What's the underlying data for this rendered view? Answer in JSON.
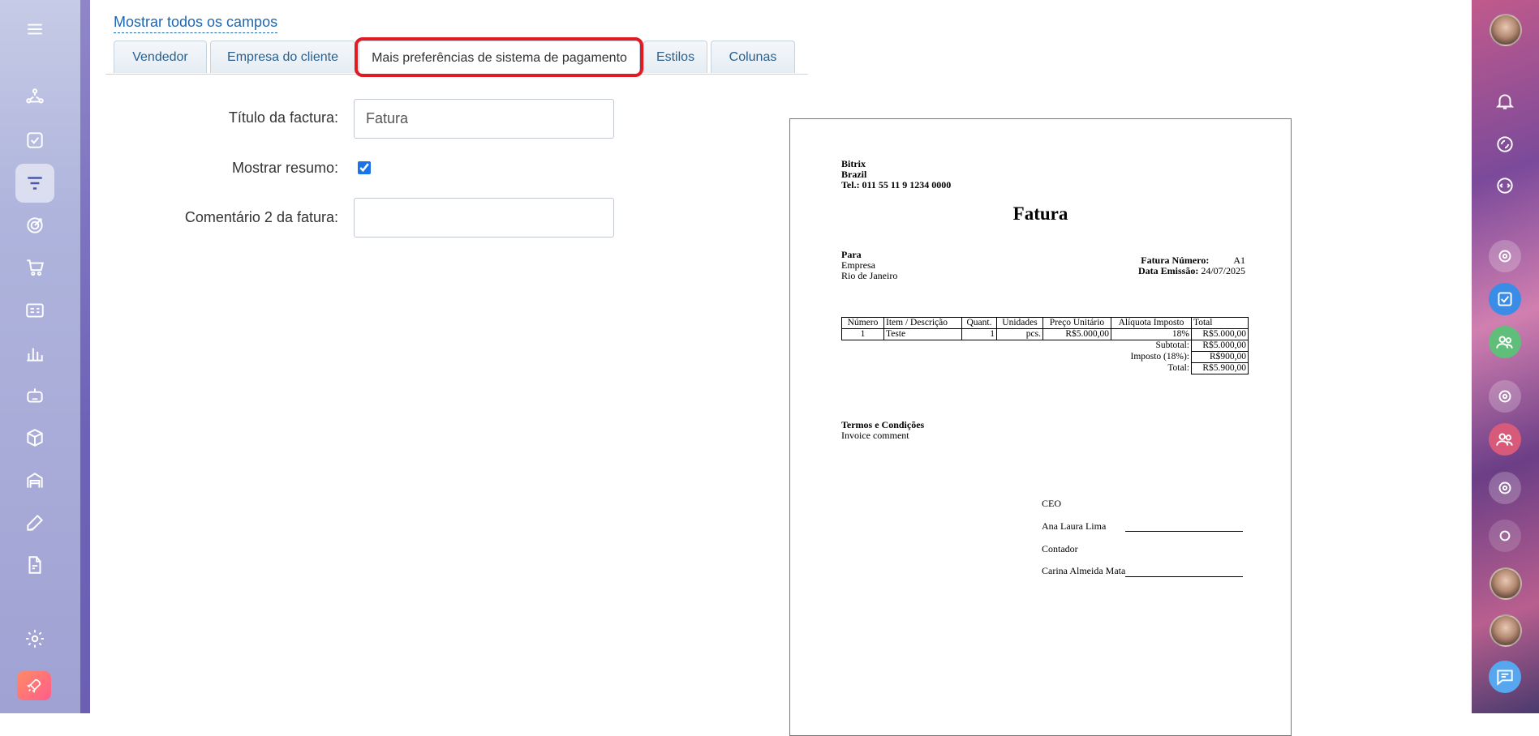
{
  "header": {
    "show_all_fields_link": "Mostrar todos os campos"
  },
  "tabs": [
    {
      "label": "Vendedor"
    },
    {
      "label": "Empresa do cliente"
    },
    {
      "label": "Mais preferências de sistema de pagamento",
      "active": true
    },
    {
      "label": "Estilos"
    },
    {
      "label": "Colunas"
    }
  ],
  "form": {
    "invoice_title_label": "Título da factura:",
    "invoice_title_value": "Fatura",
    "show_summary_label": "Mostrar resumo:",
    "show_summary_checked": true,
    "comment2_label": "Comentário 2 da fatura:",
    "comment2_value": ""
  },
  "invoice": {
    "seller_name": "Bitrix",
    "seller_country": "Brazil",
    "seller_phone": "Tel.: 011 55 11 9 1234 0000",
    "title": "Fatura",
    "to_label": "Para",
    "to_company": "Empresa",
    "to_city": "Rio de Janeiro",
    "number_label": "Fatura Número:",
    "number_value": "A1",
    "date_label": "Data Emissão:",
    "date_value": "24/07/2025",
    "table_headers": [
      "Número",
      "Item / Descrição",
      "Quant.",
      "Unidades",
      "Preço Unitário",
      "Alíquota Imposto",
      "Total"
    ],
    "rows": [
      [
        "1",
        "Teste",
        "1",
        "pcs.",
        "R$5.000,00",
        "18%",
        "R$5.000,00"
      ]
    ],
    "subtotal_label": "Subtotal:",
    "subtotal_value": "R$5.000,00",
    "tax_label": "Imposto (18%):",
    "tax_value": "R$900,00",
    "total_label": "Total:",
    "total_value": "R$5.900,00",
    "terms_title": "Termos e Condições",
    "terms_text": "Invoice comment",
    "sign_role_1": "CEO",
    "sign_name_1": "Ana Laura Lima",
    "sign_role_2": "Contador",
    "sign_name_2": "Carina Almeida Mata"
  },
  "left_nav_icons": [
    "menu-icon",
    "pipeline-icon",
    "task-check-icon",
    "filter-icon",
    "target-icon",
    "cart-icon",
    "id-card-icon",
    "bar-chart-icon",
    "robot-icon",
    "box-icon",
    "warehouse-icon",
    "pen-icon",
    "edit-document-icon",
    "settings-icon",
    "rocket-icon"
  ],
  "right_bar_icons": [
    "user-avatar",
    "bell-icon",
    "activity-icon",
    "chat-icon",
    "copilot-icon",
    "tasks-icon",
    "group-icon",
    "copilot-icon",
    "group-icon",
    "copilot-icon",
    "circle-icon",
    "user-avatar",
    "user-avatar",
    "messages-icon"
  ],
  "colors": {
    "accent": "#2067b0",
    "highlight": "#e01b24"
  }
}
